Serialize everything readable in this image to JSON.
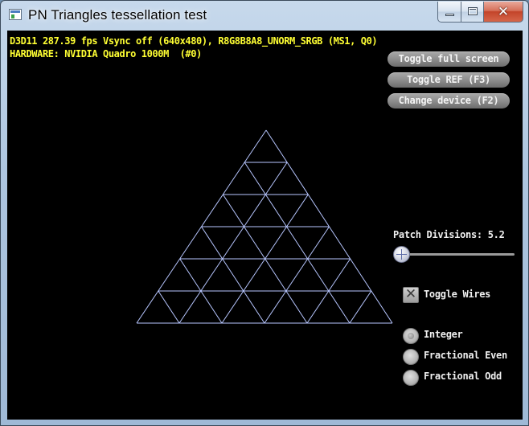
{
  "window": {
    "title": "PN Triangles tessellation test",
    "minimize_label": "",
    "maximize_label": "",
    "close_glyph": "✕"
  },
  "stats": {
    "line1": "D3D11 287.39 fps Vsync off (640x480), R8G8B8A8_UNORM_SRGB (MS1, Q0)",
    "line2": "HARDWARE: NVIDIA Quadro 1000M  (#0)"
  },
  "buttons": {
    "toggle_full_screen": "Toggle full screen",
    "toggle_ref": "Toggle REF (F3)",
    "change_device": "Change device (F2)"
  },
  "slider": {
    "label": "Patch Divisions: 5.2",
    "value": 5.2,
    "min": 1,
    "max": 32
  },
  "checkbox": {
    "label": "Toggle Wires",
    "checked": true
  },
  "partitioning": {
    "options": [
      {
        "label": "Integer",
        "selected": true
      },
      {
        "label": "Fractional Even",
        "selected": false
      },
      {
        "label": "Fractional Odd",
        "selected": false
      }
    ]
  },
  "colors": {
    "stats_text": "#ffff33",
    "wireframe": "#b7c6ff",
    "background": "#000000"
  },
  "icons": {
    "app": "window-app-icon",
    "minimize": "minimize-icon",
    "maximize": "maximize-icon",
    "close": "close-icon"
  }
}
